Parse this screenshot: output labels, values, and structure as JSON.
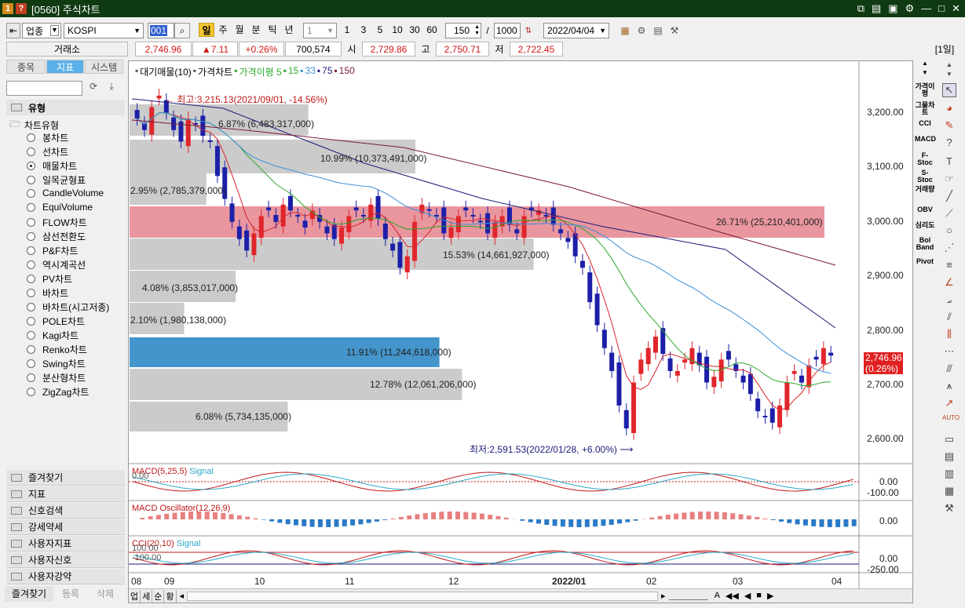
{
  "titlebar": {
    "num1": "1",
    "num2": "?",
    "title": "[0560] 주식차트"
  },
  "toolbar": {
    "market_type": "업종",
    "index_name": "KOSPI",
    "code": "001",
    "periods": [
      "일",
      "주",
      "월",
      "분",
      "틱",
      "년"
    ],
    "interval": "1",
    "interval_options": [
      "1",
      "3",
      "5",
      "10",
      "30",
      "60"
    ],
    "count": "150",
    "slash": "/",
    "total": "1000",
    "date": "2022/04/04"
  },
  "quote": {
    "exchange": "거래소",
    "price": "2,746.96",
    "change": "▲7.11",
    "change_pct": "+0.26%",
    "volume": "700,574",
    "open_label": "시",
    "open": "2,729.86",
    "high_label": "고",
    "high": "2,750.71",
    "low_label": "저",
    "low": "2,722.45",
    "period_badge": "[1일]"
  },
  "left_tabs": [
    "종목",
    "지표",
    "시스템"
  ],
  "tree": {
    "section": "유형",
    "folder": "차트유형",
    "items": [
      "봉차트",
      "선차트",
      "매물차트",
      "일목균형표",
      "CandleVolume",
      "EquiVolume",
      "FLOW차트",
      "삼선전환도",
      "P&F차트",
      "역시계곡선",
      "PV차트",
      "바차트",
      "바차트(시고저종)",
      "POLE차트",
      "Kagi차트",
      "Renko차트",
      "Swing차트",
      "분산형차트",
      "ZigZag차트"
    ],
    "selected": "매물차트"
  },
  "groups": [
    "즐겨찾기",
    "지표",
    "신호검색",
    "강세약세",
    "사용자지표",
    "사용자신호",
    "사용자강약"
  ],
  "bottom_tabs": [
    "즐겨찾기",
    "등록",
    "삭제"
  ],
  "legend": {
    "vol_profile": "대기매물(10)",
    "price_chart": "가격차트",
    "ma_label": "가격이평 5",
    "ma15": "15",
    "ma33": "33",
    "ma75": "75",
    "ma150": "150"
  },
  "annotations": {
    "high": "최고:3,215.13(2021/09/01, -14.56%)",
    "low": "최저:2,591.53(2022/01/28, +6.00%)"
  },
  "volume_profile": [
    {
      "label": "6.87% (6,483,317,000)"
    },
    {
      "label": "10.99% (10,373,491,000)"
    },
    {
      "label": "2.95% (2,785,379,000)"
    },
    {
      "label": "26.71% (25,210,401,000)"
    },
    {
      "label": "15.53% (14,661,927,000)"
    },
    {
      "label": "4.08% (3,853,017,000)"
    },
    {
      "label": "2.10% (1,980,138,000)"
    },
    {
      "label": "11.91% (11,244,618,000)"
    },
    {
      "label": "12.78% (12,061,206,000)"
    },
    {
      "label": "6.08% (5,734,135,000)"
    }
  ],
  "price_axis": [
    "3,200.00",
    "3,100.00",
    "3,000.00",
    "2,900.00",
    "2,800.00",
    "2,700.00",
    "2,600.00"
  ],
  "current_price_tag": {
    "price": "2,746.96",
    "pct": "(0.26%)"
  },
  "macd": {
    "title": "MACD(5,25,5)",
    "signal": "Signal",
    "zero": "0.00",
    "axis": [
      "0.00",
      "-100.00"
    ]
  },
  "osc": {
    "title": "MACD Oscillator(12,26,9)",
    "axis": [
      "0.00"
    ]
  },
  "cci": {
    "title": "CCI(20,10)",
    "signal": "Signal",
    "lvl1": "100.00",
    "lvl2": "-100.00",
    "axis": [
      "0.00",
      "-250.00"
    ]
  },
  "x_axis": [
    "08",
    "09",
    "10",
    "11",
    "12",
    "2022/01",
    "02",
    "03",
    "04"
  ],
  "bottom_bar": [
    "업",
    "세",
    "순",
    "황"
  ],
  "right_tools": [
    "가격이평",
    "그물차트",
    "CCI",
    "MACD",
    "F-Stoc",
    "S-Stoc",
    "거래량",
    "OBV",
    "심리도",
    "Bol Band",
    "Pivot"
  ],
  "colors": {
    "up": "#e0262b",
    "down": "#1c1fa8",
    "ma5": "#d8242a",
    "ma15": "#2aa82a",
    "ma33": "#3a8fd8",
    "ma75": "#1a1a7a",
    "ma150": "#7a1a3a",
    "profile": "#c8c8c8",
    "profile_max": "#e8909a",
    "profile_cur": "#3a8fc8"
  },
  "chart_data": {
    "type": "candlestick",
    "ylim": [
      2560,
      3260
    ],
    "x_ticks": [
      "08",
      "09",
      "10",
      "11",
      "12",
      "2022/01",
      "02",
      "03",
      "04"
    ],
    "close_series": [
      3160,
      3140,
      3180,
      3200,
      3170,
      3140,
      3120,
      3160,
      3150,
      3130,
      3120,
      3060,
      3020,
      2980,
      2950,
      2930,
      2960,
      2990,
      3000,
      2980,
      3010,
      3000,
      2990,
      2970,
      3000,
      2980,
      2960,
      2950,
      2970,
      2990,
      3000,
      2990,
      3010,
      2985,
      2950,
      2930,
      2900,
      2920,
      2980,
      3010,
      3000,
      2990,
      2960,
      2970,
      2990,
      3000,
      2990,
      2980,
      2960,
      2980,
      2990,
      2975,
      2960,
      2990,
      3000,
      3000,
      2990,
      2975,
      2960,
      2945,
      2920,
      2900,
      2840,
      2800,
      2760,
      2720,
      2660,
      2620,
      2700,
      2740,
      2760,
      2780,
      2750,
      2720,
      2720,
      2740,
      2760,
      2730,
      2700,
      2710,
      2740,
      2740,
      2720,
      2700,
      2680,
      2650,
      2640,
      2630,
      2660,
      2700,
      2720,
      2700,
      2730,
      2740,
      2760,
      2747
    ]
  }
}
